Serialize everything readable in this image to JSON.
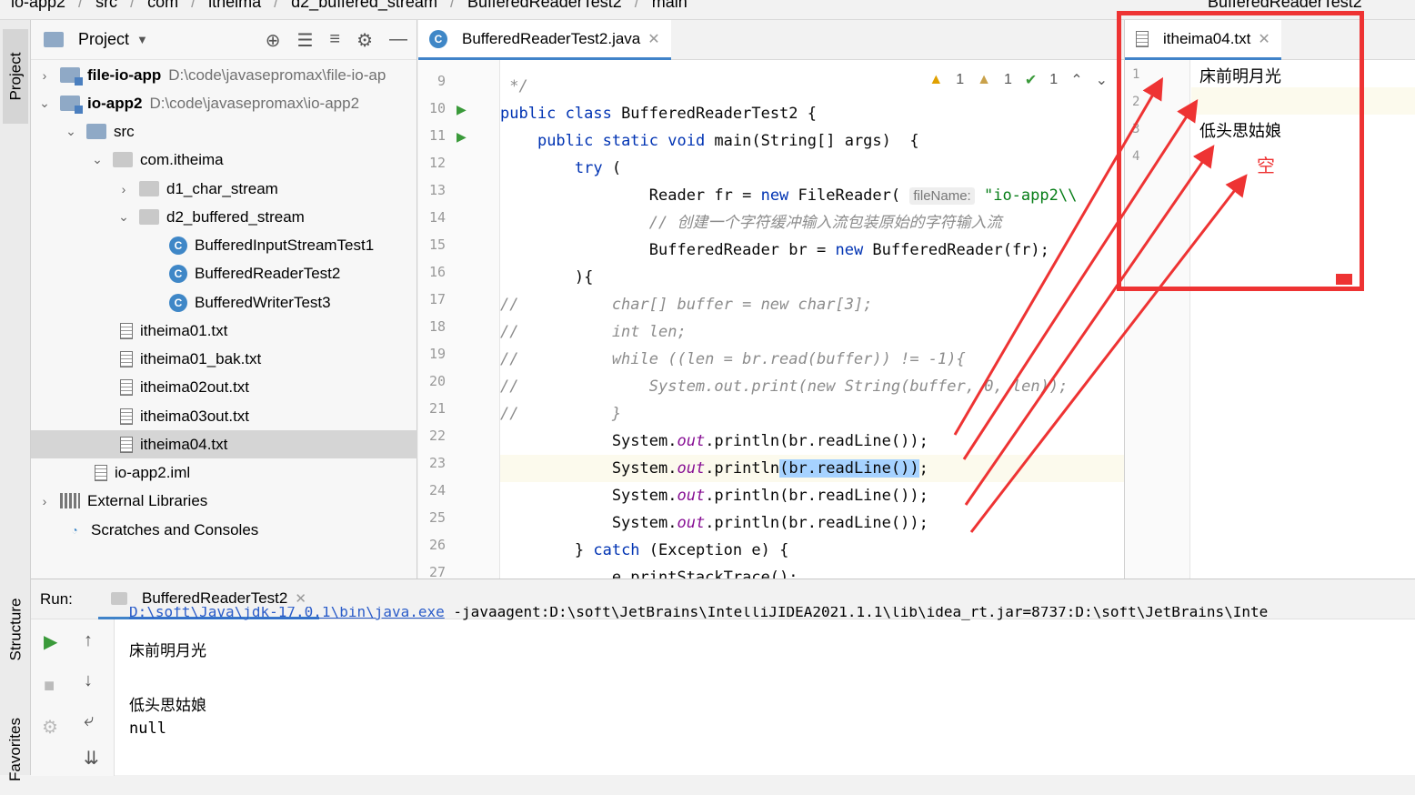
{
  "breadcrumbs": [
    "io-app2",
    "src",
    "com",
    "itheima",
    "d2_buffered_stream",
    "BufferedReaderTest2",
    "main"
  ],
  "breadcrumb_right": "BufferedReaderTest2",
  "side_tabs": {
    "project": "Project",
    "structure": "Structure",
    "favorites": "Favorites"
  },
  "project": {
    "title": "Project",
    "tree": [
      {
        "label": "file-io-app",
        "path": "D:\\code\\javasepromax\\file-io-ap",
        "bold": true
      },
      {
        "label": "io-app2",
        "path": "D:\\code\\javasepromax\\io-app2",
        "bold": true
      },
      {
        "label": "src"
      },
      {
        "label": "com.itheima"
      },
      {
        "label": "d1_char_stream"
      },
      {
        "label": "d2_buffered_stream"
      },
      {
        "label": "BufferedInputStreamTest1"
      },
      {
        "label": "BufferedReaderTest2"
      },
      {
        "label": "BufferedWriterTest3"
      },
      {
        "label": "itheima01.txt"
      },
      {
        "label": "itheima01_bak.txt"
      },
      {
        "label": "itheima02out.txt"
      },
      {
        "label": "itheima03out.txt"
      },
      {
        "label": "itheima04.txt"
      },
      {
        "label": "io-app2.iml"
      },
      {
        "label": "External Libraries"
      },
      {
        "label": "Scratches and Consoles"
      }
    ]
  },
  "editor": {
    "tab": "BufferedReaderTest2.java",
    "inspections": {
      "warnings": "1",
      "weak_warnings": "1",
      "typos": "1"
    },
    "line_numbers": [
      "9",
      "10",
      "11",
      "12",
      "13",
      "14",
      "15",
      "16",
      "17",
      "18",
      "19",
      "20",
      "21",
      "22",
      "23",
      "24",
      "25",
      "26",
      "27"
    ],
    "param_hint": "fileName:",
    "comment_cn": "// 创建一个字符缓冲输入流包装原始的字符输入流"
  },
  "txt_editor": {
    "tab": "itheima04.txt",
    "line_numbers": [
      "1",
      "2",
      "3",
      "4"
    ],
    "lines": [
      "床前明月光",
      "",
      "低头思姑娘",
      ""
    ],
    "annotation": "空"
  },
  "run": {
    "label": "Run:",
    "tab": "BufferedReaderTest2",
    "cmd": "D:\\soft\\Java\\jdk-17.0.1\\bin\\java.exe",
    "cmd_rest": " -javaagent:D:\\soft\\JetBrains\\IntelliJIDEA2021.1.1\\lib\\idea_rt.jar=8737:D:\\soft\\JetBrains\\Inte",
    "output": [
      "床前明月光",
      "",
      "低头思姑娘",
      "null"
    ]
  },
  "colors": {
    "accent": "#4083c9",
    "annotation": "#ee3333",
    "keyword": "#0033b3"
  }
}
